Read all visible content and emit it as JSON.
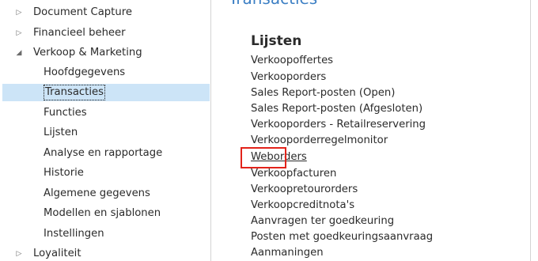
{
  "nav": {
    "items": [
      {
        "label": "Document Capture",
        "toggle": "▷"
      },
      {
        "label": "Financieel beheer",
        "toggle": "▷"
      },
      {
        "label": "Verkoop & Marketing",
        "toggle": "◢"
      },
      {
        "label": "Hoofdgegevens"
      },
      {
        "label": "Transacties",
        "selected": true
      },
      {
        "label": "Functies"
      },
      {
        "label": "Lijsten"
      },
      {
        "label": "Analyse en rapportage"
      },
      {
        "label": "Historie"
      },
      {
        "label": "Algemene gegevens"
      },
      {
        "label": "Modellen en sjablonen"
      },
      {
        "label": "Instellingen"
      },
      {
        "label": "Loyaliteit",
        "toggle": "▷"
      }
    ]
  },
  "content": {
    "page_title": "Transacties",
    "section_title": "Lijsten",
    "links": [
      "Verkoopoffertes",
      "Verkooporders",
      "Sales Report-posten (Open)",
      "Sales Report-posten (Afgesloten)",
      "Verkooporders - Retailreservering",
      "Verkooporderregelmonitor",
      "Weborders",
      "Verkoopfacturen",
      "Verkoopretourorders",
      "Verkoopcreditnota's",
      "Aanvragen ter goedkeuring",
      "Posten met goedkeuringsaanvraag",
      "Aanmaningen"
    ]
  },
  "colors": {
    "selection": "#cce4f7",
    "highlight_box": "#e2231a",
    "title_blue": "#3c7fc4"
  }
}
